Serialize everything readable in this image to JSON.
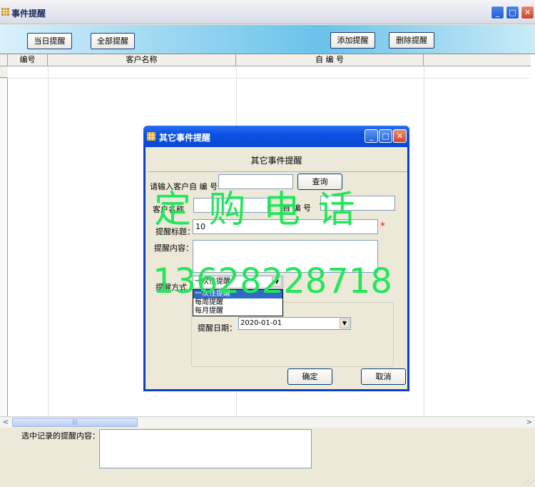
{
  "window": {
    "title": "事件提醒",
    "buttons": {
      "minimize": "_",
      "maximize": "□",
      "close": "✕"
    }
  },
  "toolbar": {
    "today_reminder": "当日提醒",
    "all_reminders": "全部提醒",
    "add_reminder": "添加提醒",
    "delete_reminder": "删除提醒"
  },
  "grid": {
    "columns": [
      "编号",
      "客户名称",
      "自 编 号"
    ]
  },
  "scrollbar": {
    "left": "<",
    "right": ">",
    "thumb_grip": "|||"
  },
  "bottom": {
    "label": "选中记录的提醒内容：",
    "content": ""
  },
  "dialog": {
    "title": "其它事件提醒",
    "heading": "其它事件提醒",
    "search_label": "请输入客户自 编 号",
    "search_value": "",
    "query_button": "查询",
    "customer_name_label": "客户名称",
    "customer_name_value": "",
    "self_id_label": "自 编 号",
    "self_id_value": "",
    "reminder_title_label": "提醒标题：",
    "reminder_title_value": "10",
    "required_mark": "*",
    "reminder_content_label": "提醒内容：",
    "reminder_content_value": "",
    "reminder_method_label": "提醒方式",
    "reminder_method_selected": "一次性提醒",
    "reminder_method_options": [
      "一次性提醒",
      "每周提醒",
      "每月提醒"
    ],
    "reminder_date_label": "提醒日期：",
    "reminder_date_value": "2020-01-01",
    "ok_button": "确定",
    "cancel_button": "取消",
    "buttons": {
      "minimize": "_",
      "maximize": "□",
      "close": "✕"
    }
  },
  "watermark": {
    "line1": "定 购 电 话",
    "line2": "13628228718"
  }
}
